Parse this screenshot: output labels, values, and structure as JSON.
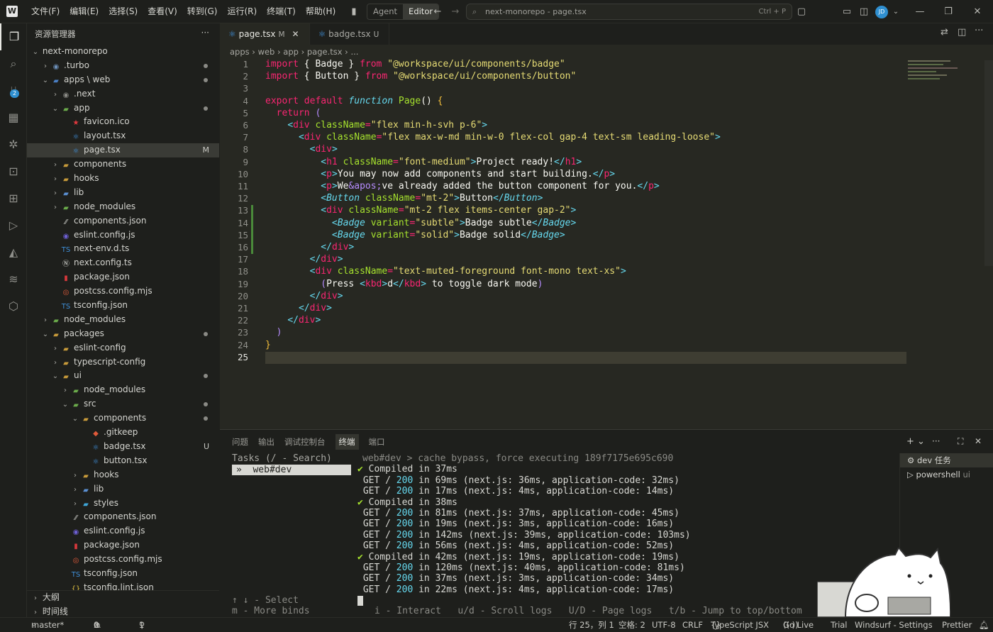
{
  "menu": [
    "文件(F)",
    "编辑(E)",
    "选择(S)",
    "查看(V)",
    "转到(G)",
    "运行(R)",
    "终端(T)",
    "帮助(H)"
  ],
  "mode_agent": "Agent",
  "mode_editor": "Editor",
  "search_text": "next-monorepo - page.tsx",
  "search_kbd": "Ctrl + P",
  "avatar": "JD",
  "explorer_title": "资源管理器",
  "tree": [
    {
      "d": 0,
      "chev": "v",
      "label": "next-monorepo",
      "ic": "",
      "c": ""
    },
    {
      "d": 1,
      "chev": ">",
      "label": ".turbo",
      "ic": "◉",
      "c": "#6c8fb8",
      "dot": true
    },
    {
      "d": 1,
      "chev": "v",
      "label": "apps \\ web",
      "ic": "▰",
      "c": "#4a7fc4",
      "dot": true
    },
    {
      "d": 2,
      "chev": ">",
      "label": ".next",
      "ic": "◉",
      "c": "#8a8a85"
    },
    {
      "d": 2,
      "chev": "v",
      "label": "app",
      "ic": "▰",
      "c": "#6bab4b",
      "dot": true
    },
    {
      "d": 3,
      "chev": "",
      "label": "favicon.ico",
      "ic": "★",
      "c": "#e5393f"
    },
    {
      "d": 3,
      "chev": "",
      "label": "layout.tsx",
      "ic": "⚛",
      "c": "#3f8fd8"
    },
    {
      "d": 3,
      "chev": "",
      "label": "page.tsx",
      "ic": "⚛",
      "c": "#3f8fd8",
      "badge": "M",
      "sel": true
    },
    {
      "d": 2,
      "chev": ">",
      "label": "components",
      "ic": "▰",
      "c": "#c79a3a"
    },
    {
      "d": 2,
      "chev": ">",
      "label": "hooks",
      "ic": "▰",
      "c": "#c79a3a"
    },
    {
      "d": 2,
      "chev": ">",
      "label": "lib",
      "ic": "▰",
      "c": "#5b8fd1"
    },
    {
      "d": 2,
      "chev": ">",
      "label": "node_modules",
      "ic": "▰",
      "c": "#6bab4b"
    },
    {
      "d": 2,
      "chev": "",
      "label": "components.json",
      "ic": "⁄⁄",
      "c": "#c8c8c3"
    },
    {
      "d": 2,
      "chev": "",
      "label": "eslint.config.js",
      "ic": "◉",
      "c": "#6d5fd3"
    },
    {
      "d": 2,
      "chev": "",
      "label": "next-env.d.ts",
      "ic": "TS",
      "c": "#3f8fd8"
    },
    {
      "d": 2,
      "chev": "",
      "label": "next.config.ts",
      "ic": "Ⓝ",
      "c": "#d8d8d3"
    },
    {
      "d": 2,
      "chev": "",
      "label": "package.json",
      "ic": "▮",
      "c": "#d6383c"
    },
    {
      "d": 2,
      "chev": "",
      "label": "postcss.config.mjs",
      "ic": "◎",
      "c": "#e05a3a"
    },
    {
      "d": 2,
      "chev": "",
      "label": "tsconfig.json",
      "ic": "TS",
      "c": "#3f8fd8"
    },
    {
      "d": 1,
      "chev": ">",
      "label": "node_modules",
      "ic": "▰",
      "c": "#6bab4b"
    },
    {
      "d": 1,
      "chev": "v",
      "label": "packages",
      "ic": "▰",
      "c": "#c79a3a",
      "dot": true
    },
    {
      "d": 2,
      "chev": ">",
      "label": "eslint-config",
      "ic": "▰",
      "c": "#c79a3a"
    },
    {
      "d": 2,
      "chev": ">",
      "label": "typescript-config",
      "ic": "▰",
      "c": "#c79a3a"
    },
    {
      "d": 2,
      "chev": "v",
      "label": "ui",
      "ic": "▰",
      "c": "#c79a3a",
      "dot": true
    },
    {
      "d": 3,
      "chev": ">",
      "label": "node_modules",
      "ic": "▰",
      "c": "#6bab4b"
    },
    {
      "d": 3,
      "chev": "v",
      "label": "src",
      "ic": "▰",
      "c": "#6bab4b",
      "dot": true
    },
    {
      "d": 4,
      "chev": "v",
      "label": "components",
      "ic": "▰",
      "c": "#c79a3a",
      "dot": true
    },
    {
      "d": 5,
      "chev": "",
      "label": ".gitkeep",
      "ic": "◆",
      "c": "#e05a3a"
    },
    {
      "d": 5,
      "chev": "",
      "label": "badge.tsx",
      "ic": "⚛",
      "c": "#3f8fd8",
      "badge": "U"
    },
    {
      "d": 5,
      "chev": "",
      "label": "button.tsx",
      "ic": "⚛",
      "c": "#3f8fd8"
    },
    {
      "d": 4,
      "chev": ">",
      "label": "hooks",
      "ic": "▰",
      "c": "#c79a3a"
    },
    {
      "d": 4,
      "chev": ">",
      "label": "lib",
      "ic": "▰",
      "c": "#5b8fd1"
    },
    {
      "d": 4,
      "chev": ">",
      "label": "styles",
      "ic": "▰",
      "c": "#3fa6d8"
    },
    {
      "d": 3,
      "chev": "",
      "label": "components.json",
      "ic": "⁄⁄",
      "c": "#c8c8c3"
    },
    {
      "d": 3,
      "chev": "",
      "label": "eslint.config.js",
      "ic": "◉",
      "c": "#6d5fd3"
    },
    {
      "d": 3,
      "chev": "",
      "label": "package.json",
      "ic": "▮",
      "c": "#d6383c"
    },
    {
      "d": 3,
      "chev": "",
      "label": "postcss.config.mjs",
      "ic": "◎",
      "c": "#e05a3a"
    },
    {
      "d": 3,
      "chev": "",
      "label": "tsconfig.json",
      "ic": "TS",
      "c": "#3f8fd8"
    },
    {
      "d": 3,
      "chev": "",
      "label": "tsconfig.lint.json",
      "ic": "{}",
      "c": "#e0c040"
    }
  ],
  "outline_label": "大纲",
  "timeline_label": "时间线",
  "tabs": [
    {
      "label": "page.tsx",
      "status": "M"
    },
    {
      "label": "badge.tsx",
      "status": "U"
    }
  ],
  "crumbs": [
    "apps",
    "web",
    "app",
    "page.tsx",
    "..."
  ],
  "code_lines": [
    [
      [
        "k",
        "import"
      ],
      [
        "p",
        " { "
      ],
      [
        "p",
        "Badge"
      ],
      [
        "p",
        " } "
      ],
      [
        "k",
        "from"
      ],
      [
        "p",
        " "
      ],
      [
        "s",
        "\"@workspace/ui/components/badge\""
      ]
    ],
    [
      [
        "k",
        "import"
      ],
      [
        "p",
        " { "
      ],
      [
        "p",
        "Button"
      ],
      [
        "p",
        " } "
      ],
      [
        "k",
        "from"
      ],
      [
        "p",
        " "
      ],
      [
        "s",
        "\"@workspace/ui/components/button\""
      ]
    ],
    [],
    [
      [
        "k",
        "export"
      ],
      [
        "p",
        " "
      ],
      [
        "k",
        "default"
      ],
      [
        "p",
        " "
      ],
      [
        "i",
        "function"
      ],
      [
        "p",
        " "
      ],
      [
        "f",
        "Page"
      ],
      [
        "p",
        "() "
      ],
      [
        "y",
        "{"
      ]
    ],
    [
      [
        "p",
        "  "
      ],
      [
        "k",
        "return"
      ],
      [
        "p",
        " "
      ],
      [
        "g",
        "("
      ]
    ],
    [
      [
        "p",
        "    "
      ],
      [
        "c",
        "<"
      ],
      [
        "t",
        "div"
      ],
      [
        "p",
        " "
      ],
      [
        "a",
        "className"
      ],
      [
        "k",
        "="
      ],
      [
        "s",
        "\"flex min-h-svh p-6\""
      ],
      [
        "c",
        ">"
      ]
    ],
    [
      [
        "p",
        "      "
      ],
      [
        "c",
        "<"
      ],
      [
        "t",
        "div"
      ],
      [
        "p",
        " "
      ],
      [
        "a",
        "className"
      ],
      [
        "k",
        "="
      ],
      [
        "s",
        "\"flex max-w-md min-w-0 flex-col gap-4 text-sm leading-loose\""
      ],
      [
        "c",
        ">"
      ]
    ],
    [
      [
        "p",
        "        "
      ],
      [
        "c",
        "<"
      ],
      [
        "t",
        "div"
      ],
      [
        "c",
        ">"
      ]
    ],
    [
      [
        "p",
        "          "
      ],
      [
        "c",
        "<"
      ],
      [
        "t",
        "h1"
      ],
      [
        "p",
        " "
      ],
      [
        "a",
        "className"
      ],
      [
        "k",
        "="
      ],
      [
        "s",
        "\"font-medium\""
      ],
      [
        "c",
        ">"
      ],
      [
        "p",
        "Project ready!"
      ],
      [
        "c",
        "</"
      ],
      [
        "t",
        "h1"
      ],
      [
        "c",
        ">"
      ]
    ],
    [
      [
        "p",
        "          "
      ],
      [
        "c",
        "<"
      ],
      [
        "t",
        "p"
      ],
      [
        "c",
        ">"
      ],
      [
        "p",
        "You may now add components and start building."
      ],
      [
        "c",
        "</"
      ],
      [
        "t",
        "p"
      ],
      [
        "c",
        ">"
      ]
    ],
    [
      [
        "p",
        "          "
      ],
      [
        "c",
        "<"
      ],
      [
        "t",
        "p"
      ],
      [
        "c",
        ">"
      ],
      [
        "p",
        "We"
      ],
      [
        "g",
        "&apos;"
      ],
      [
        "p",
        "ve already added the button component for you."
      ],
      [
        "c",
        "</"
      ],
      [
        "t",
        "p"
      ],
      [
        "c",
        ">"
      ]
    ],
    [
      [
        "p",
        "          "
      ],
      [
        "c",
        "<"
      ],
      [
        "i",
        "Button"
      ],
      [
        "p",
        " "
      ],
      [
        "a",
        "className"
      ],
      [
        "k",
        "="
      ],
      [
        "s",
        "\"mt-2\""
      ],
      [
        "c",
        ">"
      ],
      [
        "p",
        "Button"
      ],
      [
        "c",
        "</"
      ],
      [
        "i",
        "Button"
      ],
      [
        "c",
        ">"
      ]
    ],
    [
      [
        "p",
        "          "
      ],
      [
        "c",
        "<"
      ],
      [
        "t",
        "div"
      ],
      [
        "p",
        " "
      ],
      [
        "a",
        "className"
      ],
      [
        "k",
        "="
      ],
      [
        "s",
        "\"mt-2 flex items-center gap-2\""
      ],
      [
        "c",
        ">"
      ]
    ],
    [
      [
        "p",
        "            "
      ],
      [
        "c",
        "<"
      ],
      [
        "i",
        "Badge"
      ],
      [
        "p",
        " "
      ],
      [
        "a",
        "variant"
      ],
      [
        "k",
        "="
      ],
      [
        "s",
        "\"subtle\""
      ],
      [
        "c",
        ">"
      ],
      [
        "p",
        "Badge subtle"
      ],
      [
        "c",
        "</"
      ],
      [
        "i",
        "Badge"
      ],
      [
        "c",
        ">"
      ]
    ],
    [
      [
        "p",
        "            "
      ],
      [
        "c",
        "<"
      ],
      [
        "i",
        "Badge"
      ],
      [
        "p",
        " "
      ],
      [
        "a",
        "variant"
      ],
      [
        "k",
        "="
      ],
      [
        "s",
        "\"solid\""
      ],
      [
        "c",
        ">"
      ],
      [
        "p",
        "Badge solid"
      ],
      [
        "c",
        "</"
      ],
      [
        "i",
        "Badge"
      ],
      [
        "c",
        ">"
      ]
    ],
    [
      [
        "p",
        "          "
      ],
      [
        "c",
        "</"
      ],
      [
        "t",
        "div"
      ],
      [
        "c",
        ">"
      ]
    ],
    [
      [
        "p",
        "        "
      ],
      [
        "c",
        "</"
      ],
      [
        "t",
        "div"
      ],
      [
        "c",
        ">"
      ]
    ],
    [
      [
        "p",
        "        "
      ],
      [
        "c",
        "<"
      ],
      [
        "t",
        "div"
      ],
      [
        "p",
        " "
      ],
      [
        "a",
        "className"
      ],
      [
        "k",
        "="
      ],
      [
        "s",
        "\"text-muted-foreground font-mono text-xs\""
      ],
      [
        "c",
        ">"
      ]
    ],
    [
      [
        "p",
        "          "
      ],
      [
        "g",
        "("
      ],
      [
        "p",
        "Press "
      ],
      [
        "c",
        "<"
      ],
      [
        "t",
        "kbd"
      ],
      [
        "c",
        ">"
      ],
      [
        "p",
        "d"
      ],
      [
        "c",
        "</"
      ],
      [
        "t",
        "kbd"
      ],
      [
        "c",
        ">"
      ],
      [
        "p",
        " to toggle dark mode"
      ],
      [
        "g",
        ")"
      ]
    ],
    [
      [
        "p",
        "        "
      ],
      [
        "c",
        "</"
      ],
      [
        "t",
        "div"
      ],
      [
        "c",
        ">"
      ]
    ],
    [
      [
        "p",
        "      "
      ],
      [
        "c",
        "</"
      ],
      [
        "t",
        "div"
      ],
      [
        "c",
        ">"
      ]
    ],
    [
      [
        "p",
        "    "
      ],
      [
        "c",
        "</"
      ],
      [
        "t",
        "div"
      ],
      [
        "c",
        ">"
      ]
    ],
    [
      [
        "p",
        "  "
      ],
      [
        "g",
        ")"
      ]
    ],
    [
      [
        "y",
        "}"
      ]
    ],
    []
  ],
  "panel_tabs": [
    "问题",
    "输出",
    "调试控制台",
    "终端",
    "端口"
  ],
  "tasks_header": "Tasks (/ - Search)",
  "task_selected": "»  web#dev",
  "term_head": "web#dev > cache bypass, force executing 189f7175e695c690",
  "term_lines": [
    {
      "k": "ok",
      "t": "Compiled in 37ms"
    },
    {
      "k": "get",
      "code": "200",
      "t": "in 69ms (next.js: 36ms, application-code: 32ms)"
    },
    {
      "k": "get",
      "code": "200",
      "t": "in 17ms (next.js: 4ms, application-code: 14ms)"
    },
    {
      "k": "ok",
      "t": "Compiled in 38ms"
    },
    {
      "k": "get",
      "code": "200",
      "t": "in 81ms (next.js: 37ms, application-code: 45ms)"
    },
    {
      "k": "get",
      "code": "200",
      "t": "in 19ms (next.js: 3ms, application-code: 16ms)"
    },
    {
      "k": "get",
      "code": "200",
      "t": "in 142ms (next.js: 39ms, application-code: 103ms)"
    },
    {
      "k": "get",
      "code": "200",
      "t": "in 56ms (next.js: 4ms, application-code: 52ms)"
    },
    {
      "k": "ok",
      "t": "Compiled in 42ms (next.js: 19ms, application-code: 19ms)"
    },
    {
      "k": "get",
      "code": "200",
      "t": "in 120ms (next.js: 40ms, application-code: 81ms)"
    },
    {
      "k": "get",
      "code": "200",
      "t": "in 37ms (next.js: 3ms, application-code: 34ms)"
    },
    {
      "k": "get",
      "code": "200",
      "t": "in 22ms (next.js: 4ms, application-code: 17ms)"
    }
  ],
  "get_prefix": "GET / ",
  "ok_mark": "✔",
  "help_select": "↑ ↓ - Select",
  "help_binds": "m - More binds",
  "help_bar": "i - Interact   u/d - Scroll logs   U/D - Page logs   t/b - Jump to top/bottom",
  "term_list": [
    {
      "label": "dev 任务",
      "icon": "⚙"
    },
    {
      "label": "powershell",
      "sub": "ui",
      "icon": "▷"
    }
  ],
  "status": {
    "branch": "master*",
    "errors": "0",
    "warnings": "0",
    "ports": "1",
    "position": "行 25，列 1",
    "spaces": "空格: 2",
    "encoding": "UTF-8",
    "eol": "CRLF",
    "lang": "TypeScript JSX",
    "golive": "Go Live",
    "trial": "Trial",
    "windsurf": "Windsurf - Settings",
    "prettier": "Prettier"
  }
}
